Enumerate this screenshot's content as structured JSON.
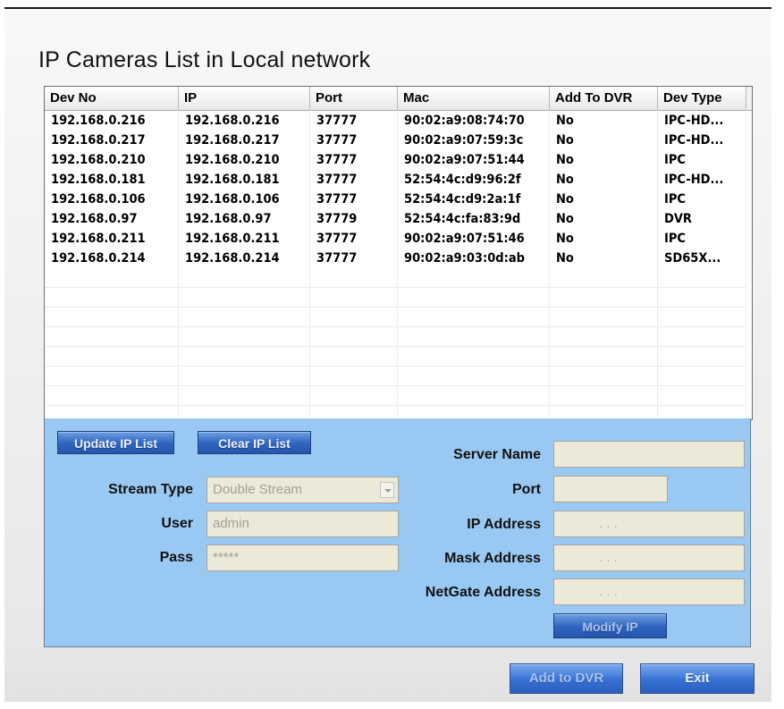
{
  "title": "IP Cameras List in Local network",
  "table": {
    "columns": [
      "Dev No",
      "IP",
      "Port",
      "Mac",
      "Add To DVR",
      "Dev Type"
    ],
    "rows": [
      [
        "192.168.0.216",
        "192.168.0.216",
        "37777",
        "90:02:a9:08:74:70",
        "No",
        "IPC-HD..."
      ],
      [
        "192.168.0.217",
        "192.168.0.217",
        "37777",
        "90:02:a9:07:59:3c",
        "No",
        "IPC-HD..."
      ],
      [
        "192.168.0.210",
        "192.168.0.210",
        "37777",
        "90:02:a9:07:51:44",
        "No",
        "IPC"
      ],
      [
        "192.168.0.181",
        "192.168.0.181",
        "37777",
        "52:54:4c:d9:96:2f",
        "No",
        "IPC-HD..."
      ],
      [
        "192.168.0.106",
        "192.168.0.106",
        "37777",
        "52:54:4c:d9:2a:1f",
        "No",
        "IPC"
      ],
      [
        "192.168.0.97",
        "192.168.0.97",
        "37779",
        "52:54:4c:fa:83:9d",
        "No",
        "DVR"
      ],
      [
        "192.168.0.211",
        "192.168.0.211",
        "37777",
        "90:02:a9:07:51:46",
        "No",
        "IPC"
      ],
      [
        "192.168.0.214",
        "192.168.0.214",
        "37777",
        "90:02:a9:03:0d:ab",
        "No",
        "SD65X..."
      ]
    ]
  },
  "panel": {
    "update_button": "Update IP List",
    "clear_button": "Clear IP List",
    "stream_type_label": "Stream Type",
    "stream_type_value": "Double Stream",
    "user_label": "User",
    "user_value": "admin",
    "pass_label": "Pass",
    "pass_value": "*****",
    "server_name_label": "Server Name",
    "port_label": "Port",
    "ip_address_label": "IP Address",
    "mask_address_label": "Mask Address",
    "netgate_address_label": "NetGate Address",
    "ip_placeholder_dots": ".          .          .",
    "modify_ip_button": "Modify IP"
  },
  "footer": {
    "add_to_dvr_button": "Add to DVR",
    "exit_button": "Exit"
  },
  "colors": {
    "panel_bg": "#99c9f2",
    "button_blue": "#2f64bf"
  }
}
